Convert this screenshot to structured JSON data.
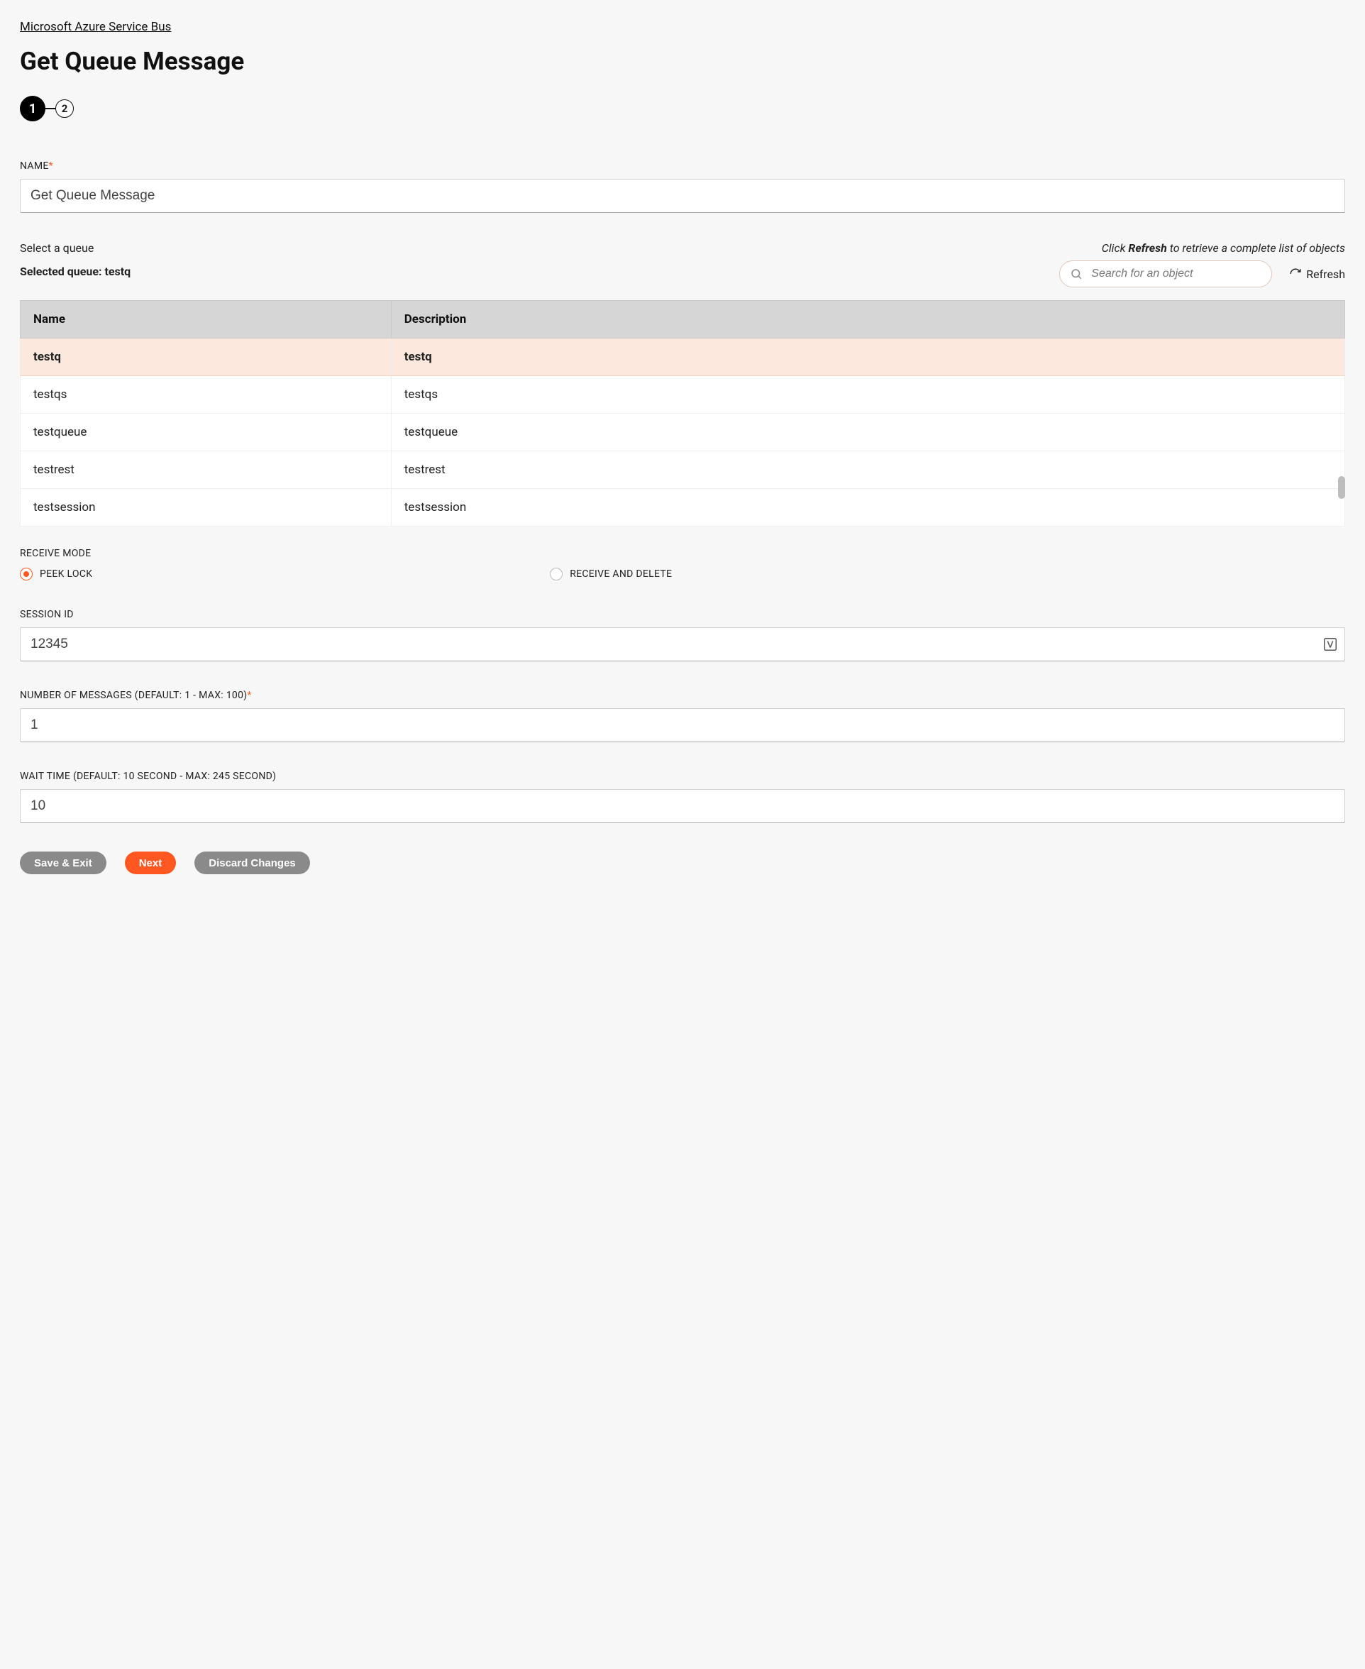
{
  "breadcrumb": "Microsoft Azure Service Bus",
  "page_title": "Get Queue Message",
  "stepper": {
    "steps": [
      "1",
      "2"
    ],
    "active_index": 0
  },
  "name_field": {
    "label": "NAME",
    "required": true,
    "value": "Get Queue Message"
  },
  "queue_section": {
    "select_label": "Select a queue",
    "selected_label_prefix": "Selected queue: ",
    "selected_queue": "testq",
    "hint_pre": "Click ",
    "hint_bold": "Refresh",
    "hint_post": " to retrieve a complete list of objects",
    "search_placeholder": "Search for an object",
    "refresh_label": "Refresh",
    "columns": [
      "Name",
      "Description"
    ],
    "rows": [
      {
        "name": "testq",
        "description": "testq",
        "selected": true
      },
      {
        "name": "testqs",
        "description": "testqs",
        "selected": false
      },
      {
        "name": "testqueue",
        "description": "testqueue",
        "selected": false
      },
      {
        "name": "testrest",
        "description": "testrest",
        "selected": false
      },
      {
        "name": "testsession",
        "description": "testsession",
        "selected": false
      }
    ]
  },
  "receive_mode": {
    "label": "RECEIVE MODE",
    "options": [
      {
        "label": "PEEK LOCK",
        "checked": true
      },
      {
        "label": "RECEIVE AND DELETE",
        "checked": false
      }
    ]
  },
  "session_id": {
    "label": "SESSION ID",
    "value": "12345"
  },
  "num_messages": {
    "label": "NUMBER OF MESSAGES (DEFAULT: 1 - MAX: 100)",
    "required": true,
    "value": "1"
  },
  "wait_time": {
    "label": "WAIT TIME (DEFAULT: 10 SECOND - MAX: 245 SECOND)",
    "value": "10"
  },
  "footer": {
    "save_exit": "Save & Exit",
    "next": "Next",
    "discard": "Discard Changes"
  }
}
